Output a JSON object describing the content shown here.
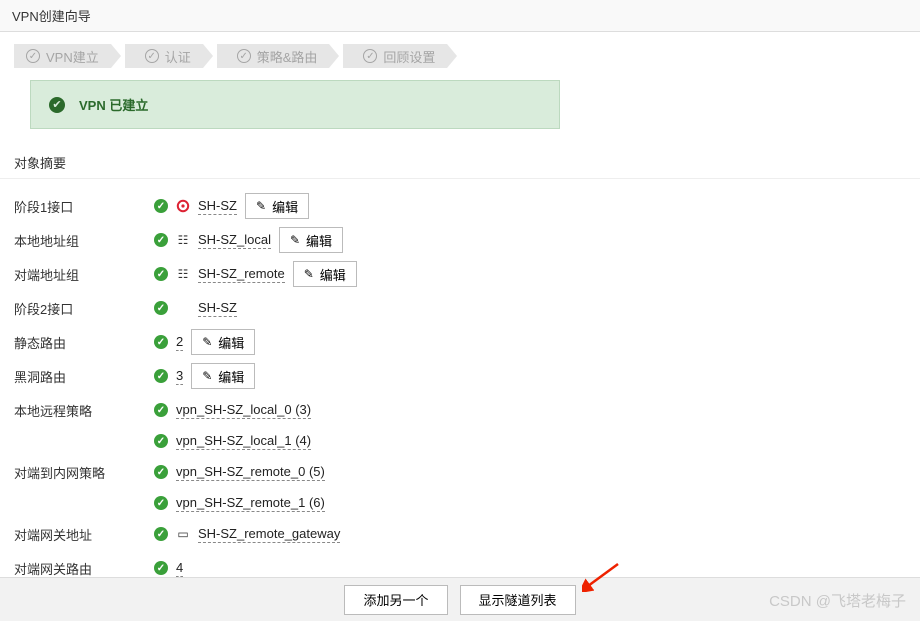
{
  "pageTitle": "VPN创建向导",
  "wizard": {
    "steps": [
      "VPN建立",
      "认证",
      "策略&路由",
      "回顾设置"
    ]
  },
  "banner": {
    "text": "VPN 已建立"
  },
  "sectionTitle": "对象摘要",
  "labels": {
    "phase1": "阶段1接口",
    "localGroup": "本地地址组",
    "remoteGroup": "对端地址组",
    "phase2": "阶段2接口",
    "staticRoute": "静态路由",
    "blackhole": "黑洞路由",
    "localPolicy": "本地远程策略",
    "remotePolicy": "对端到内网策略",
    "peerGateway": "对端网关地址",
    "peerRoute": "对端网关路由"
  },
  "values": {
    "phase1": "SH-SZ",
    "localGroup": "SH-SZ_local",
    "remoteGroup": "SH-SZ_remote",
    "phase2": "SH-SZ",
    "staticRoute": "2",
    "blackhole": "3",
    "localPolicy1": "vpn_SH-SZ_local_0 (3)",
    "localPolicy2": "vpn_SH-SZ_local_1 (4)",
    "remotePolicy1": "vpn_SH-SZ_remote_0 (5)",
    "remotePolicy2": "vpn_SH-SZ_remote_1 (6)",
    "peerGateway": "SH-SZ_remote_gateway",
    "peerRoute": "4"
  },
  "buttons": {
    "edit": "编辑",
    "addAnother": "添加另一个",
    "showTunnels": "显示隧道列表"
  },
  "watermark": "CSDN @飞塔老梅子"
}
